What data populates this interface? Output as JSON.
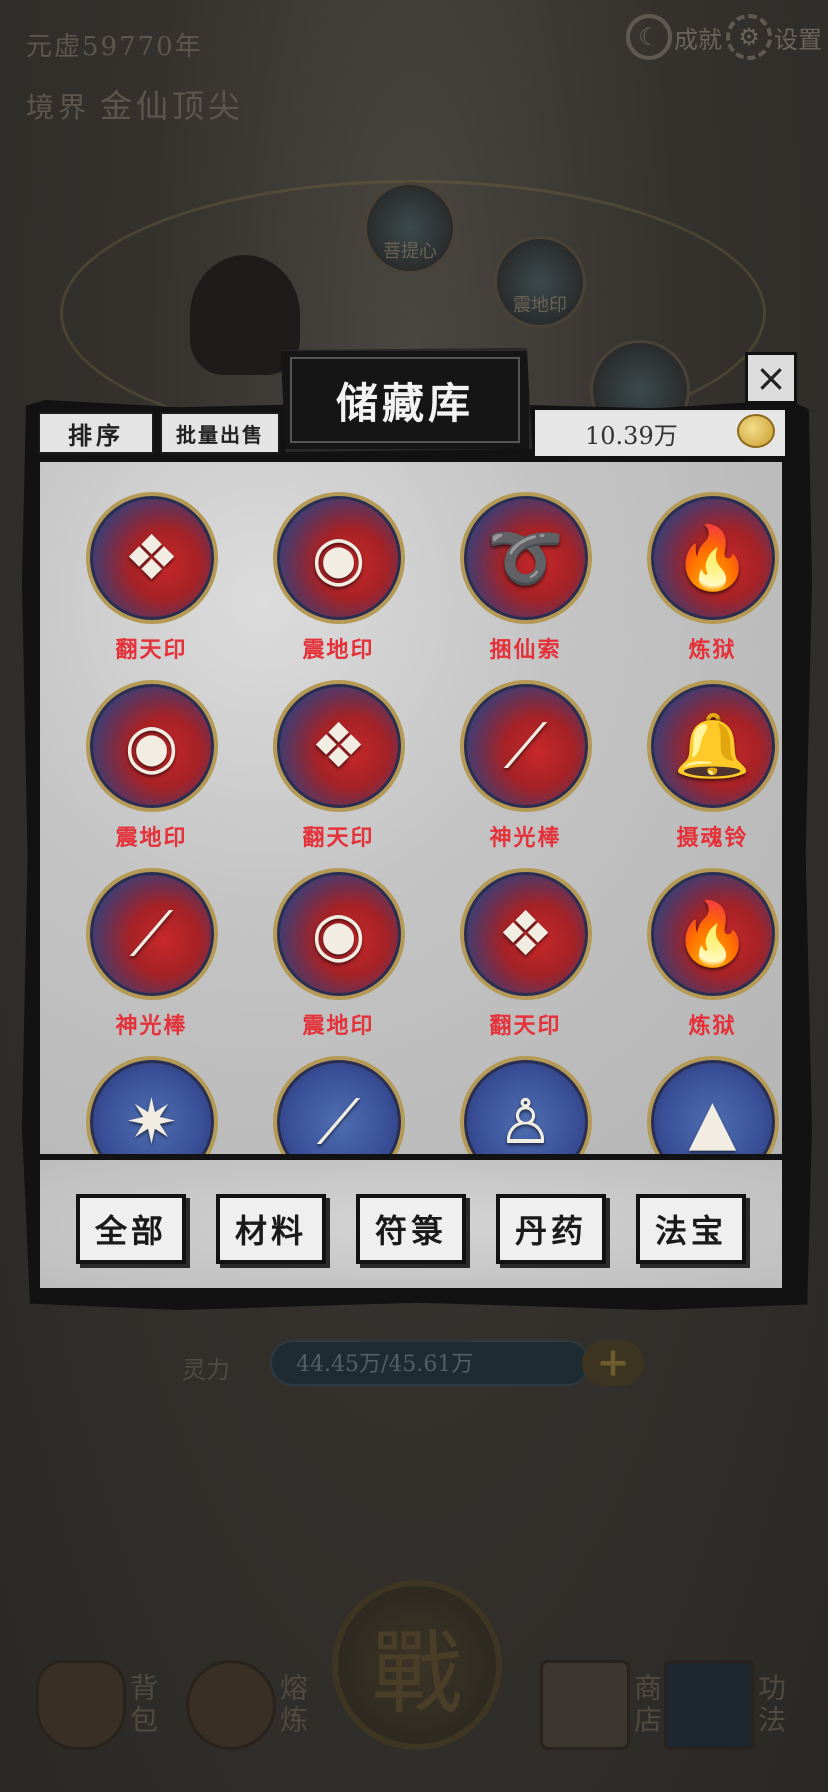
{
  "background": {
    "era": "元虚59770年",
    "realm_label": "境界",
    "realm_value": "金仙顶尖",
    "achievement_label": "成就",
    "settings_label": "设置",
    "orb1_label": "菩提心",
    "orb2_label": "震地印",
    "spirit_label": "灵力",
    "spirit_value": "44.45万/45.61万",
    "plus": "+",
    "battle": "戰",
    "nav": {
      "bag": "背包",
      "forge": "熔炼",
      "shop": "商店",
      "skills": "功法"
    }
  },
  "dialog": {
    "title": "储藏库",
    "close": "×",
    "sort_label": "排序",
    "batch_sell_label": "批量出售",
    "coins": "10.39万",
    "items": [
      {
        "name": "翻天印",
        "icon": "seal-icon",
        "glyph": "❖"
      },
      {
        "name": "震地印",
        "icon": "earth-seal-icon",
        "glyph": "◉"
      },
      {
        "name": "捆仙索",
        "icon": "rope-icon",
        "glyph": "➰"
      },
      {
        "name": "炼狱",
        "icon": "flame-icon",
        "glyph": "🔥"
      },
      {
        "name": "震地印",
        "icon": "earth-seal-icon",
        "glyph": "◉"
      },
      {
        "name": "翻天印",
        "icon": "seal-icon",
        "glyph": "❖"
      },
      {
        "name": "神光棒",
        "icon": "staff-icon",
        "glyph": "⟋"
      },
      {
        "name": "摄魂铃",
        "icon": "bell-icon",
        "glyph": "🔔"
      },
      {
        "name": "神光棒",
        "icon": "staff-icon",
        "glyph": "⟋"
      },
      {
        "name": "震地印",
        "icon": "earth-seal-icon",
        "glyph": "◉"
      },
      {
        "name": "翻天印",
        "icon": "seal-icon",
        "glyph": "❖"
      },
      {
        "name": "炼狱",
        "icon": "flame-icon",
        "glyph": "🔥"
      },
      {
        "name": "",
        "icon": "star-blade-icon",
        "glyph": "✷"
      },
      {
        "name": "",
        "icon": "spear-icon",
        "glyph": "⟋"
      },
      {
        "name": "",
        "icon": "puppet-icon",
        "glyph": "♙"
      },
      {
        "name": "",
        "icon": "pagoda-icon",
        "glyph": "▲"
      }
    ],
    "filters": [
      "全部",
      "材料",
      "符箓",
      "丹药",
      "法宝"
    ]
  }
}
